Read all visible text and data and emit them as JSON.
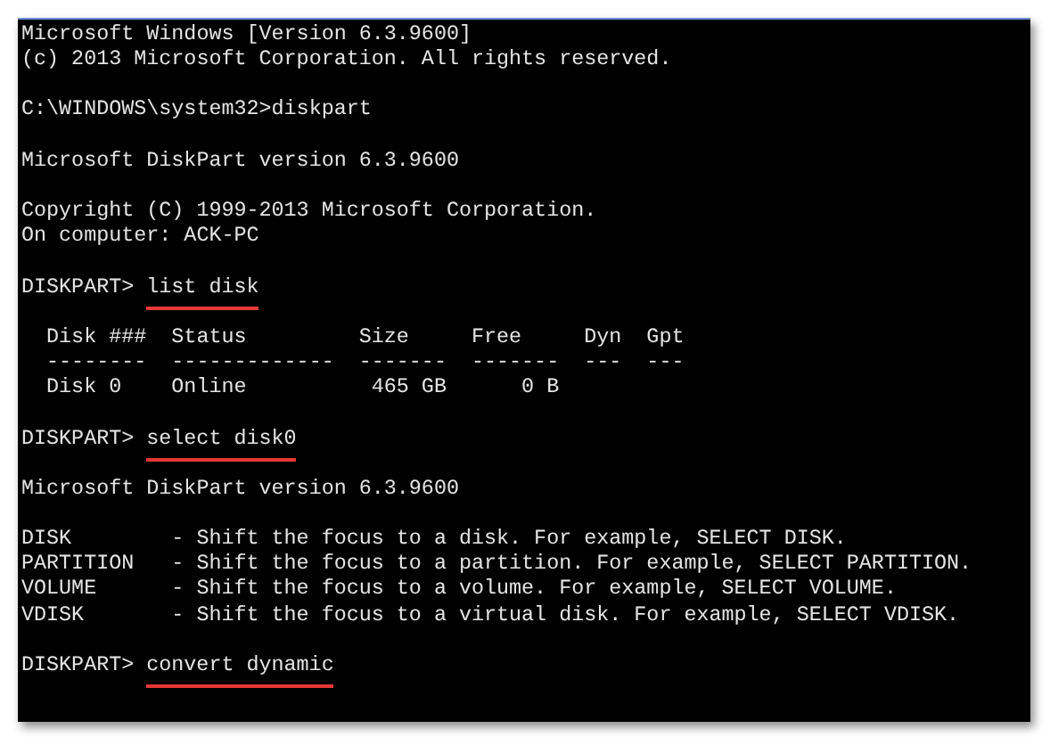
{
  "console": {
    "blocks": [
      {
        "lines": [
          {
            "kind": "output",
            "text": "Microsoft Windows [Version 6.3.9600]"
          },
          {
            "kind": "output",
            "text": "(c) 2013 Microsoft Corporation. All rights reserved."
          }
        ]
      },
      {
        "lines": [
          {
            "kind": "output",
            "text": "C:\\WINDOWS\\system32>diskpart"
          }
        ]
      },
      {
        "lines": [
          {
            "kind": "output",
            "text": "Microsoft DiskPart version 6.3.9600"
          }
        ]
      },
      {
        "lines": [
          {
            "kind": "output",
            "text": "Copyright (C) 1999-2013 Microsoft Corporation."
          },
          {
            "kind": "output",
            "text": "On computer: ACK-PC"
          }
        ]
      },
      {
        "lines": [
          {
            "kind": "command",
            "prompt": "DISKPART>",
            "command": "list disk",
            "highlighted": true
          }
        ]
      },
      {
        "lines": [
          {
            "kind": "output",
            "text": "  Disk ###  Status         Size     Free     Dyn  Gpt"
          },
          {
            "kind": "output",
            "text": "  --------  -------------  -------  -------  ---  ---"
          },
          {
            "kind": "output",
            "text": "  Disk 0    Online          465 GB      0 B"
          }
        ]
      },
      {
        "lines": [
          {
            "kind": "command",
            "prompt": "DISKPART>",
            "command": "select disk0",
            "highlighted": true
          }
        ]
      },
      {
        "lines": [
          {
            "kind": "output",
            "text": "Microsoft DiskPart version 6.3.9600"
          }
        ]
      },
      {
        "lines": [
          {
            "kind": "output",
            "text": "DISK        - Shift the focus to a disk. For example, SELECT DISK."
          },
          {
            "kind": "output",
            "text": "PARTITION   - Shift the focus to a partition. For example, SELECT PARTITION."
          },
          {
            "kind": "output",
            "text": "VOLUME      - Shift the focus to a volume. For example, SELECT VOLUME."
          },
          {
            "kind": "output",
            "text": "VDISK       - Shift the focus to a virtual disk. For example, SELECT VDISK."
          }
        ]
      },
      {
        "lines": [
          {
            "kind": "command",
            "prompt": "DISKPART>",
            "command": "convert dynamic",
            "highlighted": true
          }
        ]
      }
    ]
  }
}
